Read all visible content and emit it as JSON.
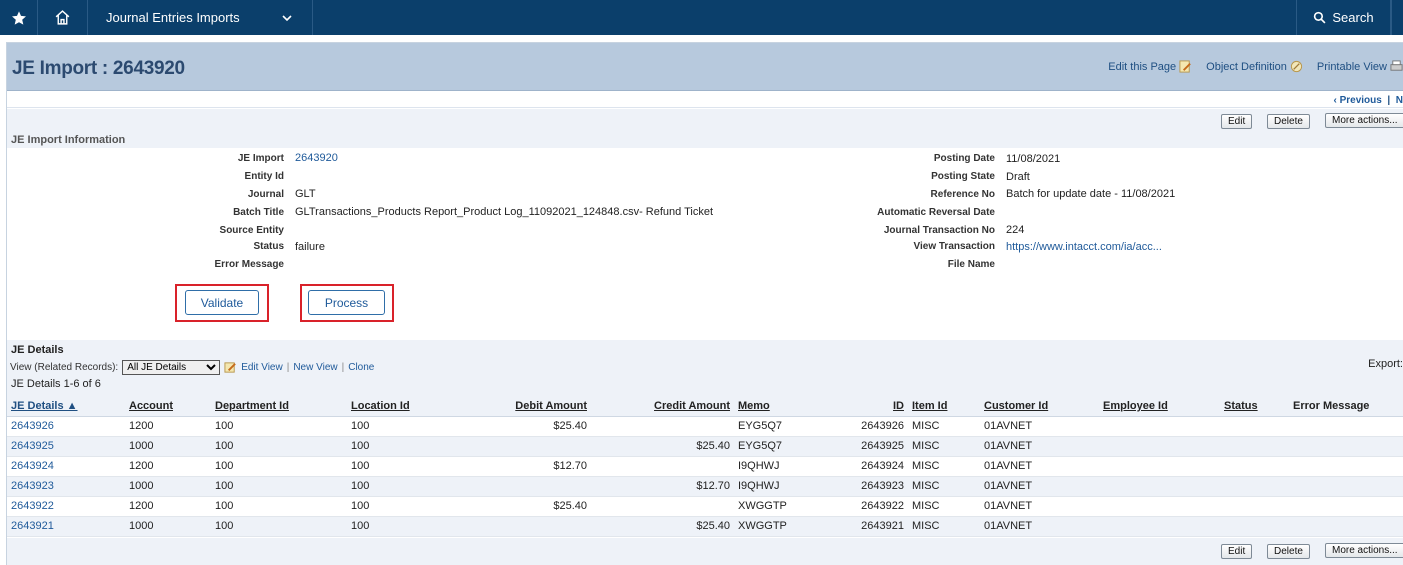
{
  "nav": {
    "module_label": "Journal Entries Imports",
    "search_label": "Search"
  },
  "header": {
    "title": "JE Import : 2643920",
    "edit_page": "Edit this Page",
    "object_definition": "Object Definition",
    "printable_view": "Printable View",
    "previous": "‹ Previous",
    "separator": "|",
    "next": "N"
  },
  "actions": {
    "edit": "Edit",
    "delete": "Delete",
    "more": "More actions..."
  },
  "info_section": {
    "heading": "JE Import Information",
    "left": [
      {
        "label": "JE Import",
        "value": "2643920",
        "link": true
      },
      {
        "label": "Entity Id",
        "value": ""
      },
      {
        "label": "Journal",
        "value": "GLT"
      },
      {
        "label": "Batch Title",
        "value": "GLTransactions_Products Report_Product Log_11092021_124848.csv- Refund Ticket"
      },
      {
        "label": "Source Entity",
        "value": ""
      },
      {
        "label": "Status",
        "value": "failure"
      },
      {
        "label": "Error Message",
        "value": ""
      }
    ],
    "right": [
      {
        "label": "Posting Date",
        "value": "11/08/2021"
      },
      {
        "label": "Posting State",
        "value": "Draft"
      },
      {
        "label": "Reference No",
        "value": "Batch for update date - 11/08/2021"
      },
      {
        "label": "Automatic Reversal Date",
        "value": ""
      },
      {
        "label": "Journal Transaction No",
        "value": "224"
      },
      {
        "label": "View Transaction",
        "value": "https://www.intacct.com/ia/acc...",
        "link": true
      },
      {
        "label": "File Name",
        "value": ""
      }
    ],
    "validate_label": "Validate",
    "process_label": "Process",
    "highlight_color": "#d9222a"
  },
  "details": {
    "heading": "JE Details",
    "view_label": "View (Related Records):",
    "view_selected": "All JE Details",
    "edit_view": "Edit View",
    "new_view": "New View",
    "clone": "Clone",
    "separator": "|",
    "export_label": "Export:",
    "count_label": "JE Details 1-6 of 6",
    "columns": [
      "JE Details ▲",
      "Account",
      "Department Id",
      "Location Id",
      "Debit Amount",
      "Credit Amount",
      "Memo",
      "ID",
      "Item Id",
      "Customer Id",
      "Employee Id",
      "Status",
      "Error Message"
    ],
    "rows": [
      [
        "2643926",
        "1200",
        "100",
        "100",
        "$25.40",
        "",
        "EYG5Q7",
        "2643926",
        "MISC",
        "01AVNET",
        "",
        "",
        ""
      ],
      [
        "2643925",
        "1000",
        "100",
        "100",
        "",
        "$25.40",
        "EYG5Q7",
        "2643925",
        "MISC",
        "01AVNET",
        "",
        "",
        ""
      ],
      [
        "2643924",
        "1200",
        "100",
        "100",
        "$12.70",
        "",
        "I9QHWJ",
        "2643924",
        "MISC",
        "01AVNET",
        "",
        "",
        ""
      ],
      [
        "2643923",
        "1000",
        "100",
        "100",
        "",
        "$12.70",
        "I9QHWJ",
        "2643923",
        "MISC",
        "01AVNET",
        "",
        "",
        ""
      ],
      [
        "2643922",
        "1200",
        "100",
        "100",
        "$25.40",
        "",
        "XWGGTP",
        "2643922",
        "MISC",
        "01AVNET",
        "",
        "",
        ""
      ],
      [
        "2643921",
        "1000",
        "100",
        "100",
        "",
        "$25.40",
        "XWGGTP",
        "2643921",
        "MISC",
        "01AVNET",
        "",
        "",
        ""
      ]
    ]
  }
}
